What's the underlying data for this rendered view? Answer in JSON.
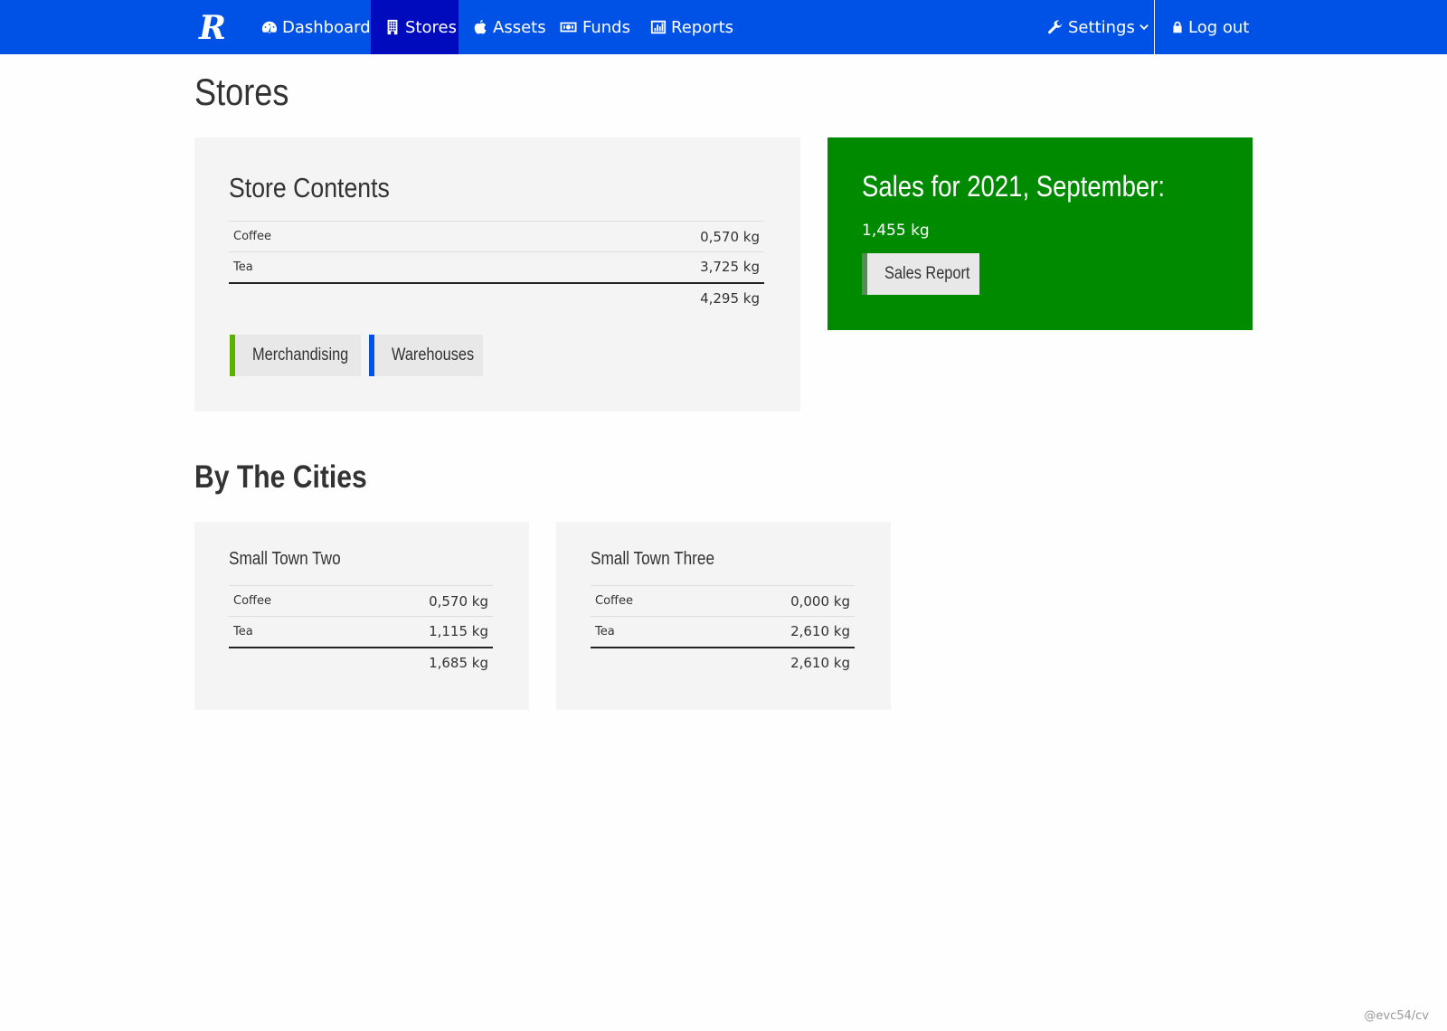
{
  "nav": {
    "logo_letter": "R",
    "items": [
      {
        "label": "Dashboard",
        "icon": "dashboard-icon"
      },
      {
        "label": "Stores",
        "icon": "building-icon",
        "active": true
      },
      {
        "label": "Assets",
        "icon": "apple-icon"
      },
      {
        "label": "Funds",
        "icon": "money-icon"
      },
      {
        "label": "Reports",
        "icon": "bar-chart-icon"
      }
    ],
    "settings_label": "Settings",
    "logout_label": "Log out",
    "color": "#0052e6",
    "active_color": "#000bbd"
  },
  "page": {
    "title": "Stores"
  },
  "store_contents": {
    "title": "Store Contents",
    "rows": [
      {
        "name": "Coffee",
        "value": "0,570 kg"
      },
      {
        "name": "Tea",
        "value": "3,725 kg"
      }
    ],
    "total": "4,295 kg",
    "buttons": [
      {
        "label": "Merchandising",
        "accent": "#5cb000"
      },
      {
        "label": "Warehouses",
        "accent": "#0052e6"
      }
    ]
  },
  "sales": {
    "title": "Sales for 2021, September:",
    "amount": "1,455 kg",
    "button_label": "Sales Report",
    "color": "#008a00"
  },
  "cities": {
    "title": "By The Cities",
    "items": [
      {
        "name": "Small Town Two",
        "rows": [
          {
            "name": "Coffee",
            "value": "0,570 kg"
          },
          {
            "name": "Tea",
            "value": "1,115 kg"
          }
        ],
        "total": "1,685 kg"
      },
      {
        "name": "Small Town Three",
        "rows": [
          {
            "name": "Coffee",
            "value": "0,000 kg"
          },
          {
            "name": "Tea",
            "value": "2,610 kg"
          }
        ],
        "total": "2,610 kg"
      }
    ]
  },
  "footer": {
    "watermark": "@evc54/cv"
  }
}
